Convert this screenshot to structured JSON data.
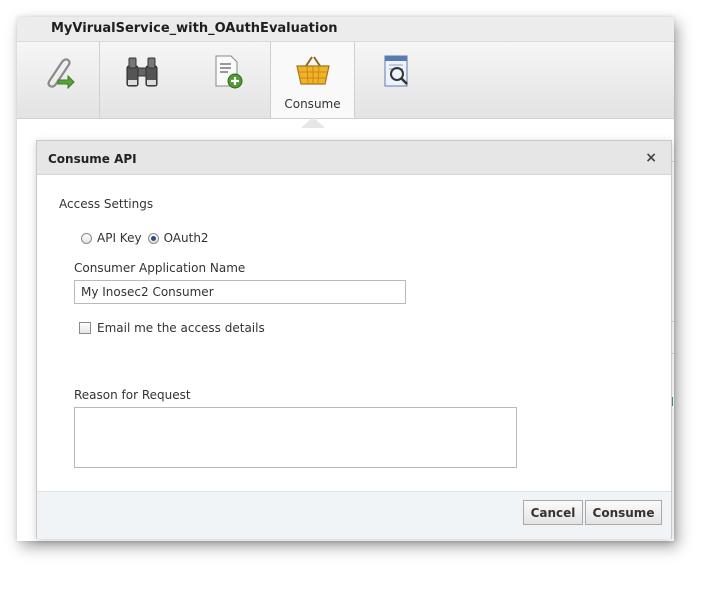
{
  "window": {
    "title": "MyVirualService_with_OAuthEvaluation"
  },
  "toolbar": {
    "items": [
      {
        "icon": "paperclip-arrow-icon",
        "label": ""
      },
      {
        "icon": "binoculars-icon",
        "label": ""
      },
      {
        "icon": "document-add-icon",
        "label": ""
      },
      {
        "icon": "basket-icon",
        "label": "Consume"
      },
      {
        "icon": "document-search-icon",
        "label": ""
      }
    ],
    "active_index": 3
  },
  "dialog": {
    "title": "Consume API",
    "close_symbol": "×",
    "access_settings_title": "Access Settings",
    "auth_options": [
      {
        "label": "API Key",
        "selected": false
      },
      {
        "label": "OAuth2",
        "selected": true
      }
    ],
    "consumer_app_label": "Consumer Application Name",
    "consumer_app_value": "My Inosec2 Consumer",
    "email_checkbox_label": "Email me the access details",
    "email_checked": false,
    "reason_label": "Reason for Request",
    "reason_value": "",
    "buttons": {
      "cancel": "Cancel",
      "consume": "Consume"
    }
  },
  "colors": {
    "radio_selected": "#2b4f7e",
    "footer_bg": "#f1f4f7",
    "header_bg": "#e6e6e6",
    "basket": "#e8a317"
  }
}
